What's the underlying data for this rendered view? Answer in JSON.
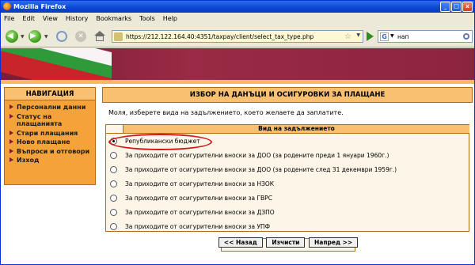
{
  "window": {
    "title": "Mozilla Firefox"
  },
  "menu": [
    "File",
    "Edit",
    "View",
    "History",
    "Bookmarks",
    "Tools",
    "Help"
  ],
  "toolbar": {
    "url": "https://212.122.164.40:4351/taxpay/client/select_tax_type.php",
    "search_query": "нап"
  },
  "nav": {
    "title": "НАВИГАЦИЯ",
    "items": [
      "Персонални данни",
      "Статус на плащанията",
      "Стари плащания",
      "Ново плащане",
      "Въпроси и отговори",
      "Изход"
    ]
  },
  "main": {
    "heading": "ИЗБОР НА ДАНЪЦИ И ОСИГУРОВКИ ЗА ПЛАЩАНЕ",
    "prompt": "Моля, изберете вида на задължението, което желаете да заплатите.",
    "column_header": "Вид на задължението",
    "selected_index": 0,
    "options": [
      "Републикански бюджет",
      "За приходите от осигурителни вноски за ДОО (за родените преди 1 януари 1960г.)",
      "За приходите от осигурителни вноски за ДОО (за родените след 31 декември 1959г.)",
      "За приходите от осигурителни вноски за НЗОК",
      "За приходите от осигурителни вноски за ГВРС",
      "За приходите от осигурителни вноски за ДЗПО",
      "За приходите от осигурителни вноски за УПФ"
    ],
    "buttons": {
      "back": "<< Назад",
      "clear": "Изчисти",
      "next": "Напред >>"
    }
  }
}
